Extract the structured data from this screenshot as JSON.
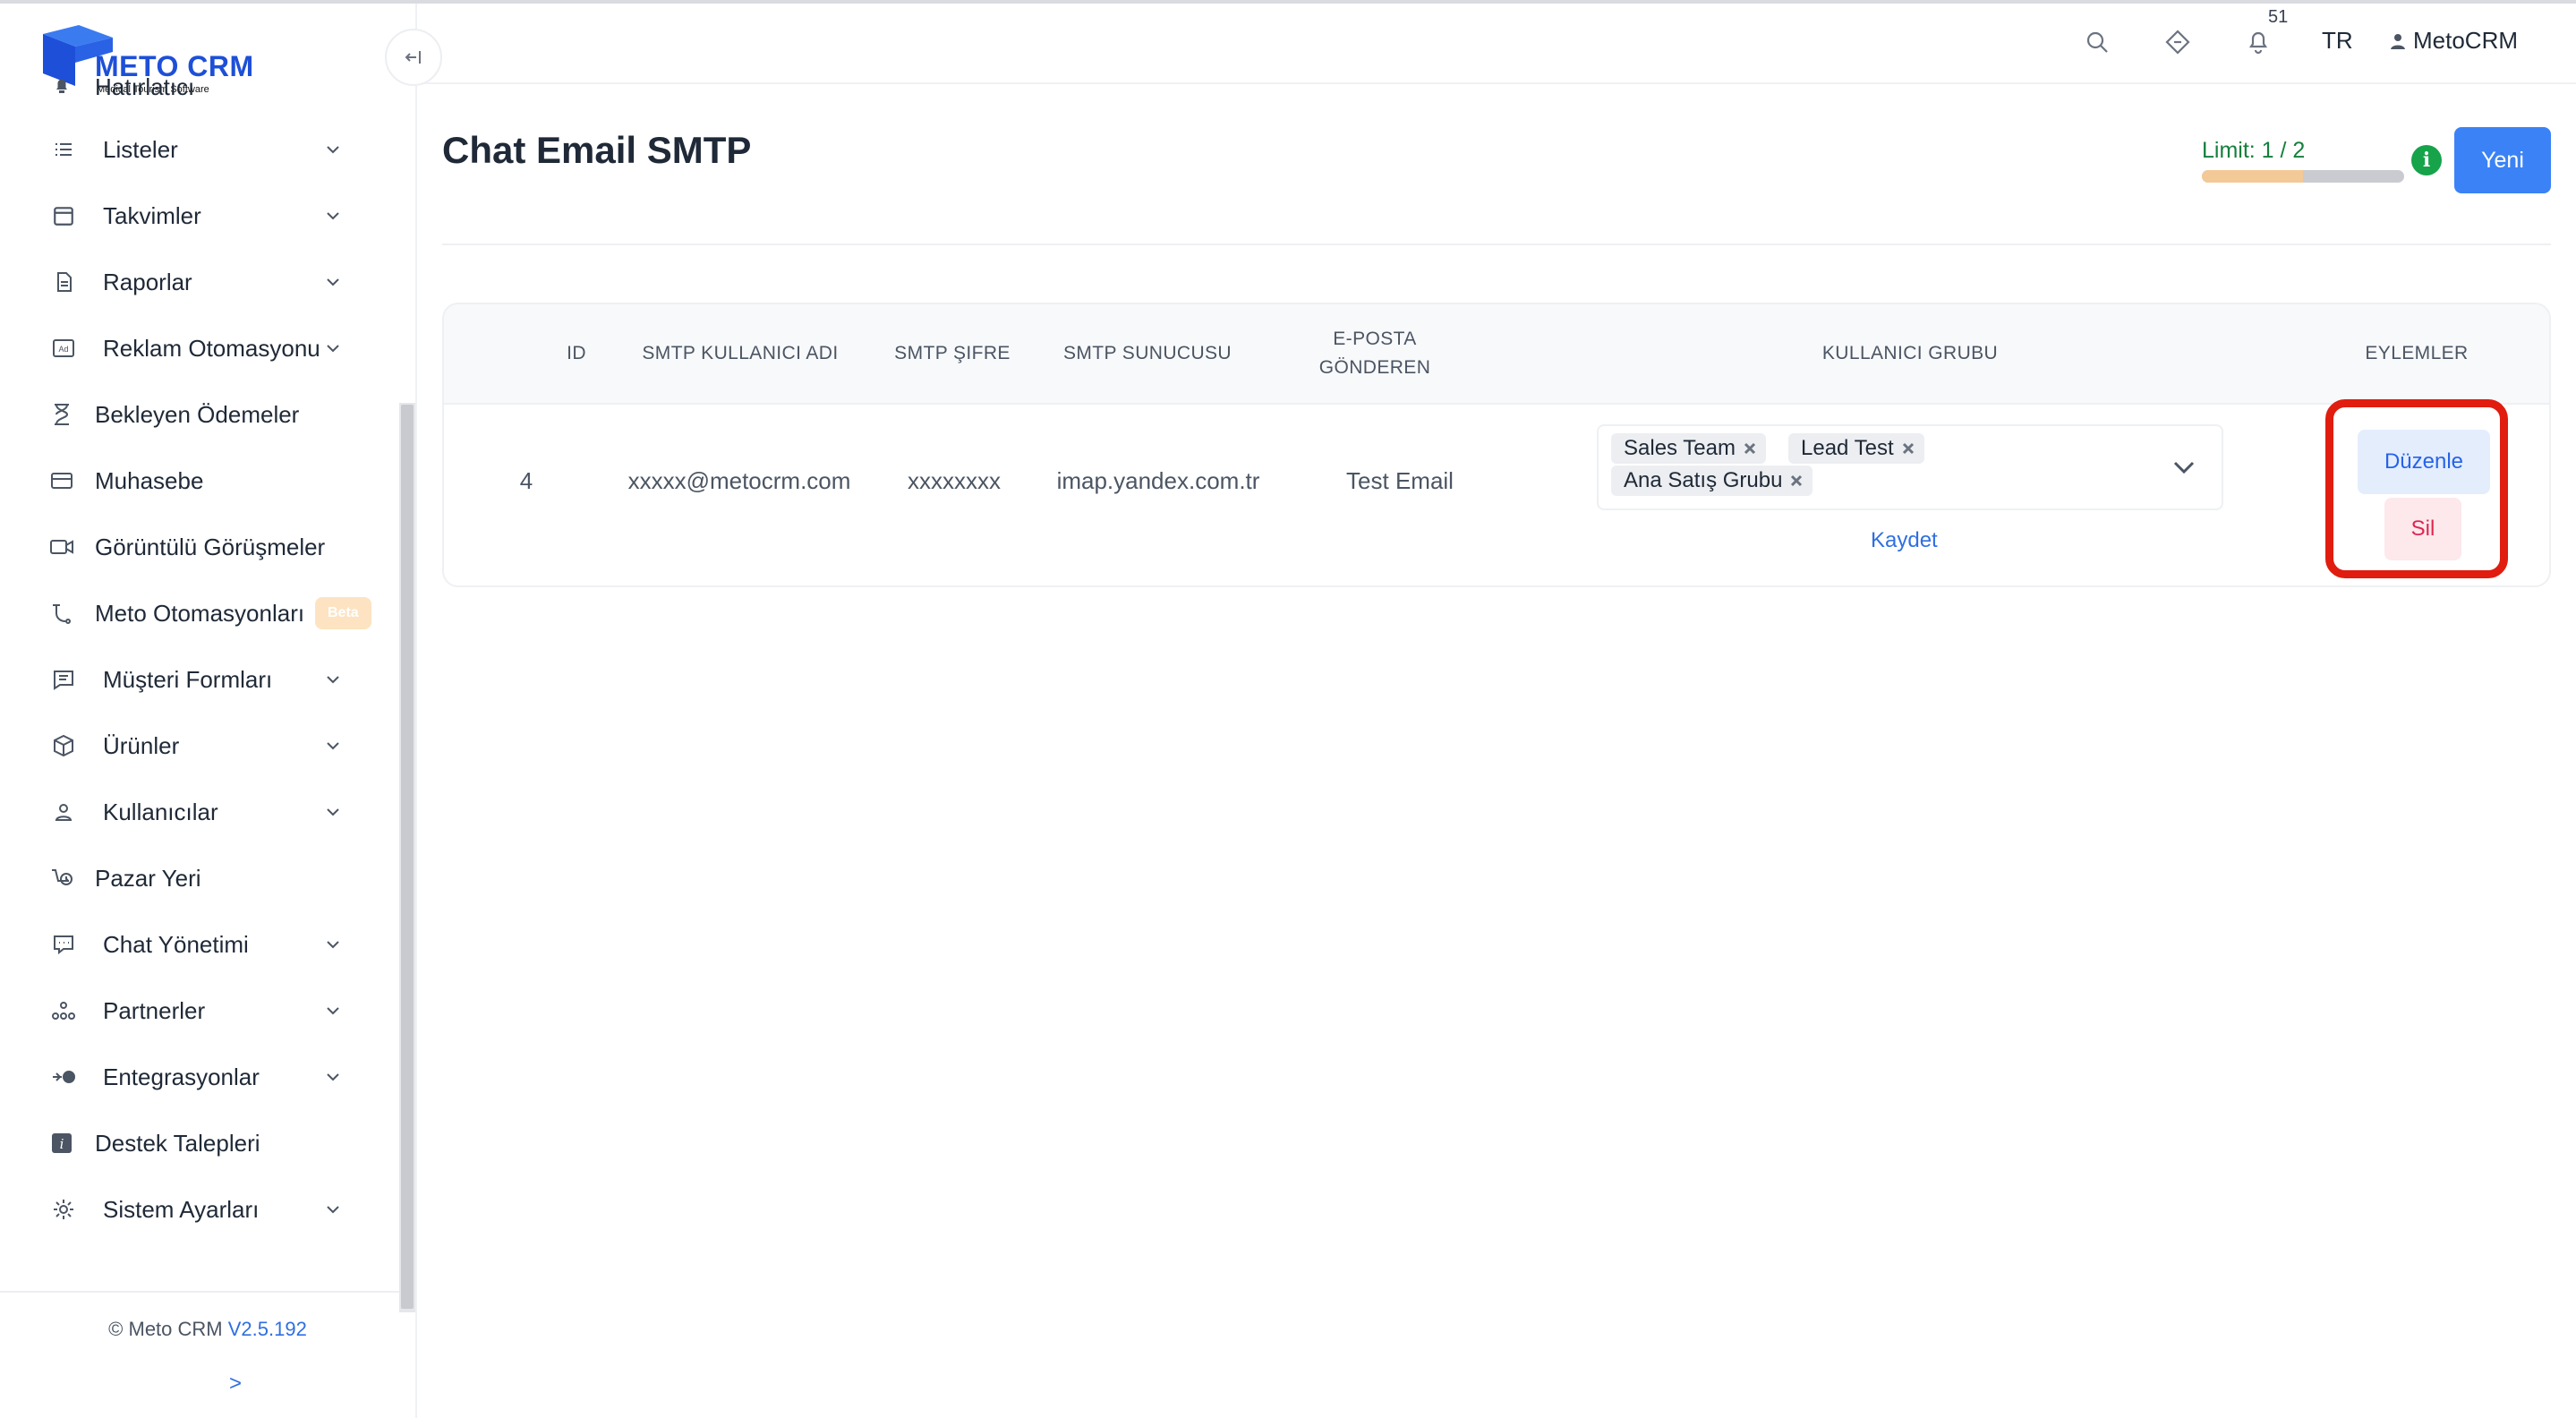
{
  "brand": {
    "name": "METO CRM",
    "tagline": "Medical Tourism Software",
    "color": "#1d4fd8"
  },
  "sidebar": {
    "items": [
      {
        "label": "Hatırlatıcı",
        "icon": "bell-icon",
        "has_submenu": false
      },
      {
        "label": "Listeler",
        "icon": "list-icon",
        "has_submenu": true
      },
      {
        "label": "Takvimler",
        "icon": "calendar-icon",
        "has_submenu": true
      },
      {
        "label": "Raporlar",
        "icon": "report-icon",
        "has_submenu": true
      },
      {
        "label": "Reklam Otomasyonu",
        "icon": "ad-icon",
        "has_submenu": true
      },
      {
        "label": "Bekleyen Ödemeler",
        "icon": "hourglass-icon",
        "has_submenu": false
      },
      {
        "label": "Muhasebe",
        "icon": "credit-card-icon",
        "has_submenu": false
      },
      {
        "label": "Görüntülü Görüşmeler",
        "icon": "video-icon",
        "has_submenu": false
      },
      {
        "label": "Meto Otomasyonları",
        "icon": "workflow-icon",
        "has_submenu": false,
        "badge": "Beta"
      },
      {
        "label": "Müşteri Formları",
        "icon": "form-icon",
        "has_submenu": true
      },
      {
        "label": "Ürünler",
        "icon": "box-icon",
        "has_submenu": true
      },
      {
        "label": "Kullanıcılar",
        "icon": "user-icon",
        "has_submenu": true
      },
      {
        "label": "Pazar Yeri",
        "icon": "marketplace-icon",
        "has_submenu": false
      },
      {
        "label": "Chat Yönetimi",
        "icon": "chat-icon",
        "has_submenu": true
      },
      {
        "label": "Partnerler",
        "icon": "partners-icon",
        "has_submenu": true
      },
      {
        "label": "Entegrasyonlar",
        "icon": "integration-icon",
        "has_submenu": true
      },
      {
        "label": "Destek Talepleri",
        "icon": "support-icon",
        "has_submenu": false
      },
      {
        "label": "Sistem Ayarları",
        "icon": "gear-icon",
        "has_submenu": true
      }
    ],
    "footer": {
      "copyright": "© Meto CRM",
      "version": "V2.5.192",
      "expand": ">"
    }
  },
  "header": {
    "notification_count": "51",
    "language": "TR",
    "user_name": "MetoCRM"
  },
  "page": {
    "title": "Chat Email SMTP",
    "limit_text": "Limit: 1 / 2",
    "limit_used": 1,
    "limit_total": 2,
    "info_symbol": "i",
    "new_button": "Yeni"
  },
  "table": {
    "columns": [
      "ID",
      "SMTP KULLANICI ADI",
      "SMTP ŞIFRE",
      "SMTP SUNUCUSU",
      "E-POSTA\nGÖNDEREN",
      "KULLANICI GRUBU",
      "EYLEMLER"
    ],
    "rows": [
      {
        "id": "4",
        "username": "xxxxx@metocrm.com",
        "password": "xxxxxxxx",
        "server": "imap.yandex.com.tr",
        "sender": "Test Email",
        "groups": [
          "Sales Team",
          "Lead Test",
          "Ana Satış Grubu"
        ],
        "save": "Kaydet",
        "edit": "Düzenle",
        "delete": "Sil"
      }
    ]
  },
  "colors": {
    "primary": "#3b82f6",
    "link": "#2f6fe0",
    "success": "#16a34a",
    "highlight": "#e01d0f",
    "danger": "#dc2650"
  }
}
